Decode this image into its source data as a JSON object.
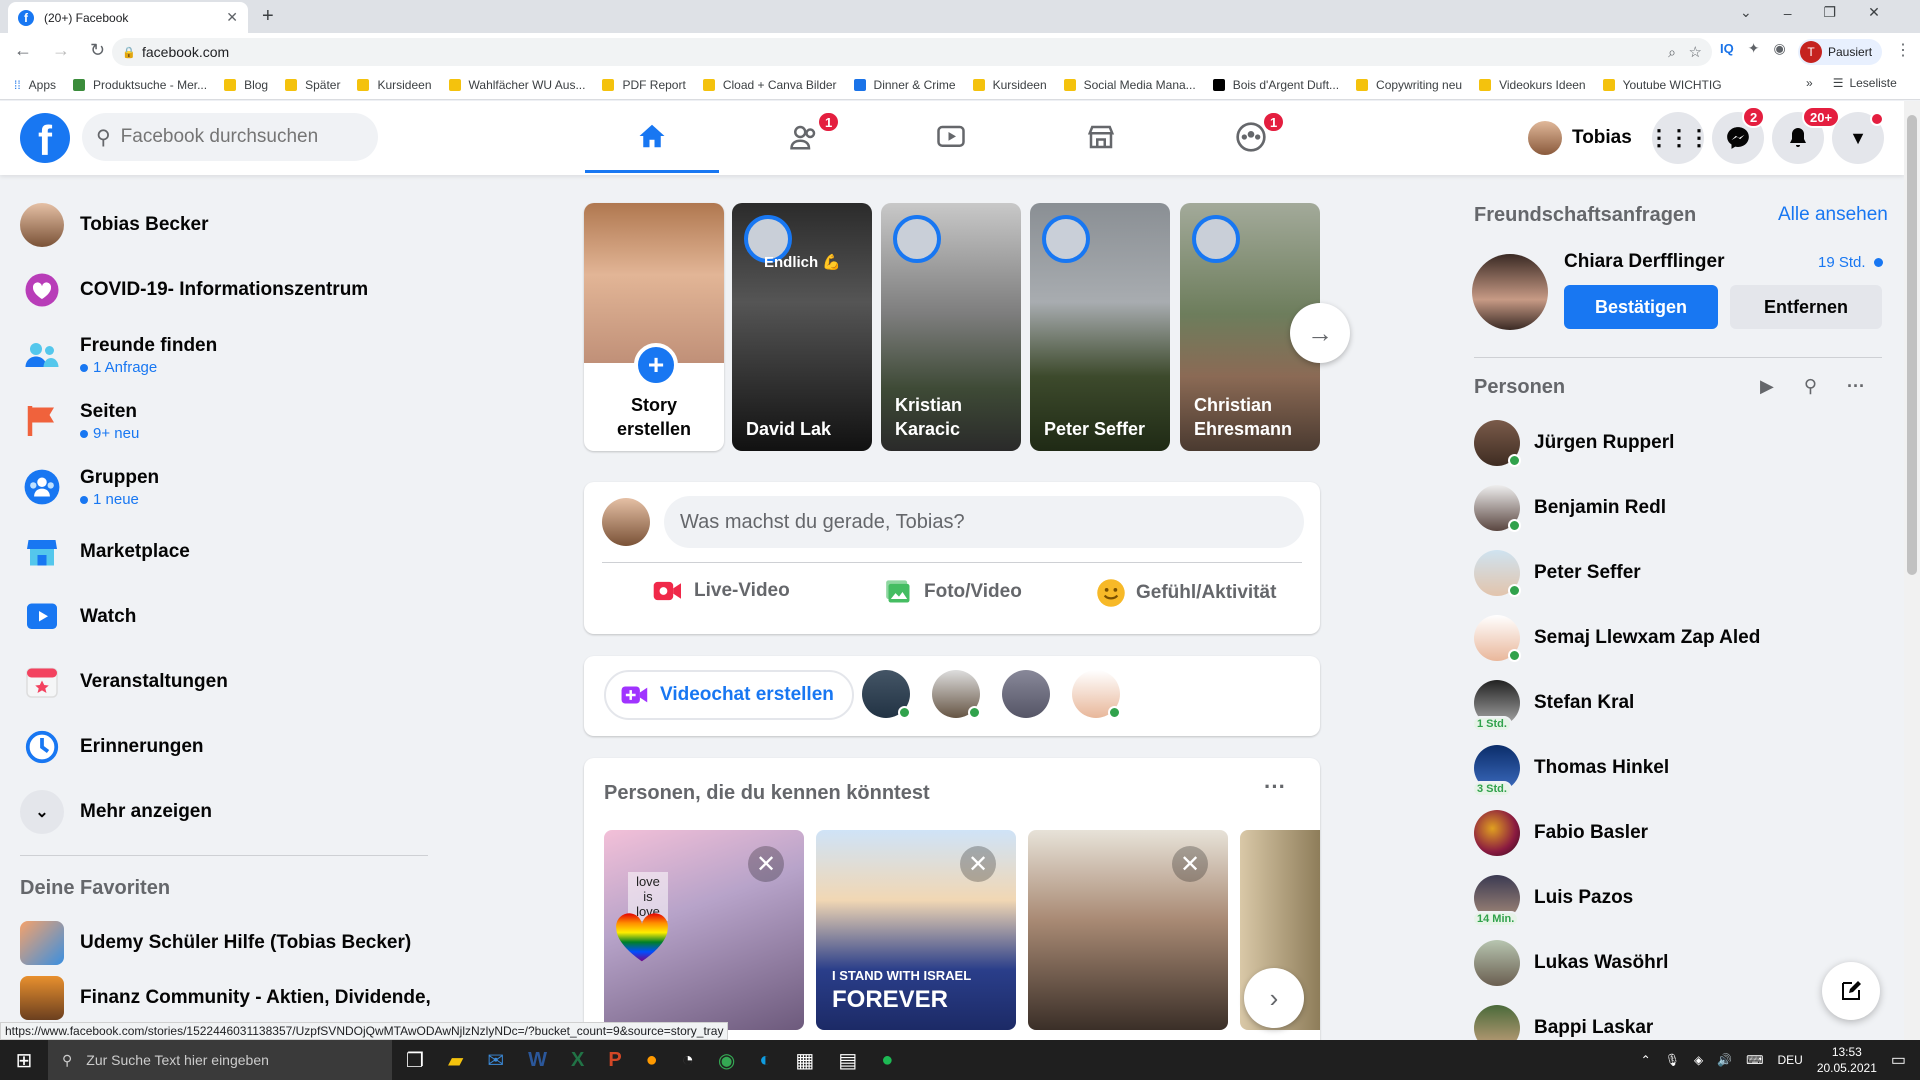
{
  "browser": {
    "tab_title": "(20+) Facebook",
    "url": "facebook.com",
    "profile_label": "Pausiert",
    "profile_initial": "T",
    "bookmarks": [
      "Apps",
      "Produktsuche - Mer...",
      "Blog",
      "Später",
      "Kursideen",
      "Wahlfächer WU Aus...",
      "PDF Report",
      "Cload + Canva Bilder",
      "Dinner & Crime",
      "Kursideen",
      "Social Media Mana...",
      "Bois d'Argent Duft...",
      "Copywriting neu",
      "Videokurs Ideen",
      "Youtube WICHTIG"
    ],
    "reading_list": "Leseliste",
    "more_bookmarks": "»",
    "status_url": "https://www.facebook.com/stories/1522446031138357/UzpfSVNDOjQwMTAwODAwNjlzNzlyNDc=/?bucket_count=9&source=story_tray"
  },
  "header": {
    "search_placeholder": "Facebook durchsuchen",
    "friends_badge": "1",
    "groups_badge": "1",
    "user_name": "Tobias",
    "messenger_badge": "2",
    "notifications_badge": "20+",
    "brand_color": "#1877f2"
  },
  "left_nav": {
    "items": [
      {
        "label": "Tobias Becker",
        "sub": ""
      },
      {
        "label": "COVID-19- Informationszentrum",
        "sub": ""
      },
      {
        "label": "Freunde finden",
        "sub": "1 Anfrage"
      },
      {
        "label": "Seiten",
        "sub": "9+ neu"
      },
      {
        "label": "Gruppen",
        "sub": "1 neue"
      },
      {
        "label": "Marketplace",
        "sub": ""
      },
      {
        "label": "Watch",
        "sub": ""
      },
      {
        "label": "Veranstaltungen",
        "sub": ""
      },
      {
        "label": "Erinnerungen",
        "sub": ""
      },
      {
        "label": "Mehr anzeigen",
        "sub": ""
      }
    ],
    "favorites_title": "Deine Favoriten",
    "favorites": [
      "Udemy Schüler Hilfe (Tobias Becker)",
      "Finanz Community - Aktien, Dividende,"
    ]
  },
  "stories": {
    "create_label_1": "Story",
    "create_label_2": "erstellen",
    "items": [
      {
        "name_1": "David Lak",
        "name_2": "",
        "overlay": "Endlich 💪"
      },
      {
        "name_1": "Kristian",
        "name_2": "Karacic",
        "overlay": ""
      },
      {
        "name_1": "Peter Seffer",
        "name_2": "",
        "overlay": ""
      },
      {
        "name_1": "Christian",
        "name_2": "Ehresmann",
        "overlay": ""
      }
    ]
  },
  "composer": {
    "placeholder": "Was machst du gerade, Tobias?",
    "live_label": "Live-Video",
    "photo_label": "Foto/Video",
    "feeling_label": "Gefühl/Aktivität"
  },
  "rooms": {
    "label": "Videochat erstellen"
  },
  "pymk": {
    "title": "Personen, die du kennen könntest",
    "card2_text_1": "I STAND WITH ISRAEL",
    "card2_text_2": "FOREVER",
    "card1_text": "love is love"
  },
  "right": {
    "requests_title": "Freundschaftsanfragen",
    "see_all": "Alle ansehen",
    "request_name": "Chiara Derfflinger",
    "request_time": "19 Std.",
    "confirm": "Bestätigen",
    "remove": "Entfernen",
    "contacts_title": "Personen",
    "contacts": [
      {
        "name": "Jürgen Rupperl",
        "status": ""
      },
      {
        "name": "Benjamin Redl",
        "status": ""
      },
      {
        "name": "Peter Seffer",
        "status": ""
      },
      {
        "name": "Semaj Llewxam Zap Aled",
        "status": ""
      },
      {
        "name": "Stefan Kral",
        "status": "1 Std."
      },
      {
        "name": "Thomas Hinkel",
        "status": "3 Std."
      },
      {
        "name": "Fabio Basler",
        "status": ""
      },
      {
        "name": "Luis Pazos",
        "status": "14 Min."
      },
      {
        "name": "Lukas Wasöhrl",
        "status": ""
      },
      {
        "name": "Bappi Laskar",
        "status": ""
      }
    ]
  },
  "taskbar": {
    "search": "Zur Suche Text hier eingeben",
    "lang": "DEU",
    "time": "13:53",
    "date": "20.05.2021"
  }
}
